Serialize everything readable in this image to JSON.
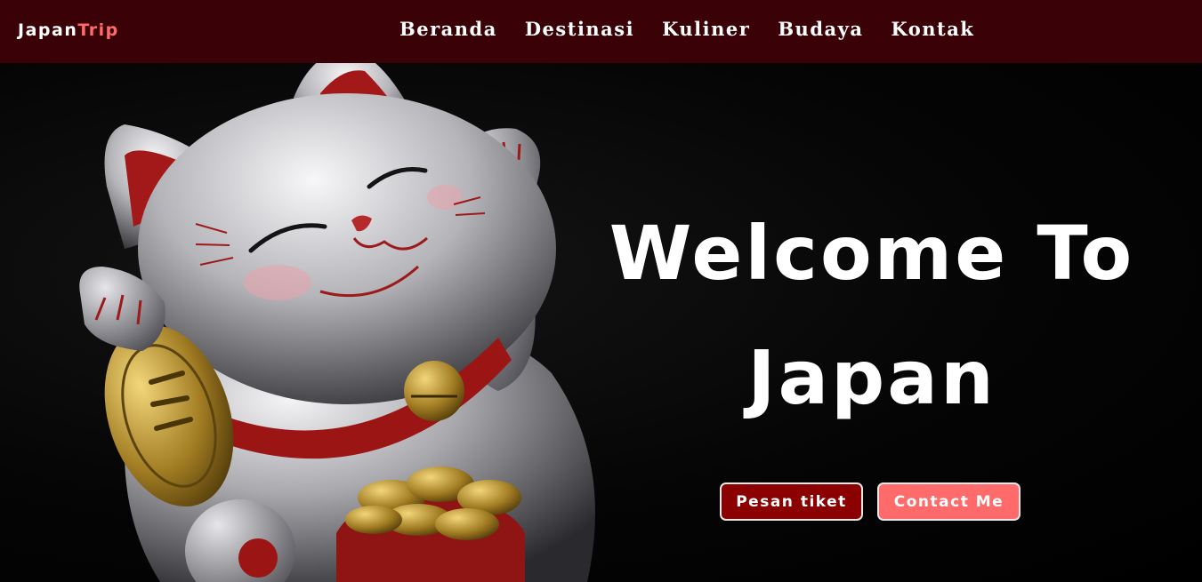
{
  "brand": {
    "primary": "Japan",
    "accent": "Trip"
  },
  "nav": {
    "items": [
      "Beranda",
      "Destinasi",
      "Kuliner",
      "Budaya",
      "Kontak"
    ]
  },
  "hero": {
    "title_line1": "Welcome To",
    "title_line2": "Japan",
    "primary_button": "Pesan tiket",
    "secondary_button": "Contact Me",
    "image": "maneki-neko lucky cat figurine"
  },
  "colors": {
    "navbar": "#3a0206",
    "accent": "#ff6b6b",
    "primary_button": "#8b0000",
    "background": "#000000"
  }
}
